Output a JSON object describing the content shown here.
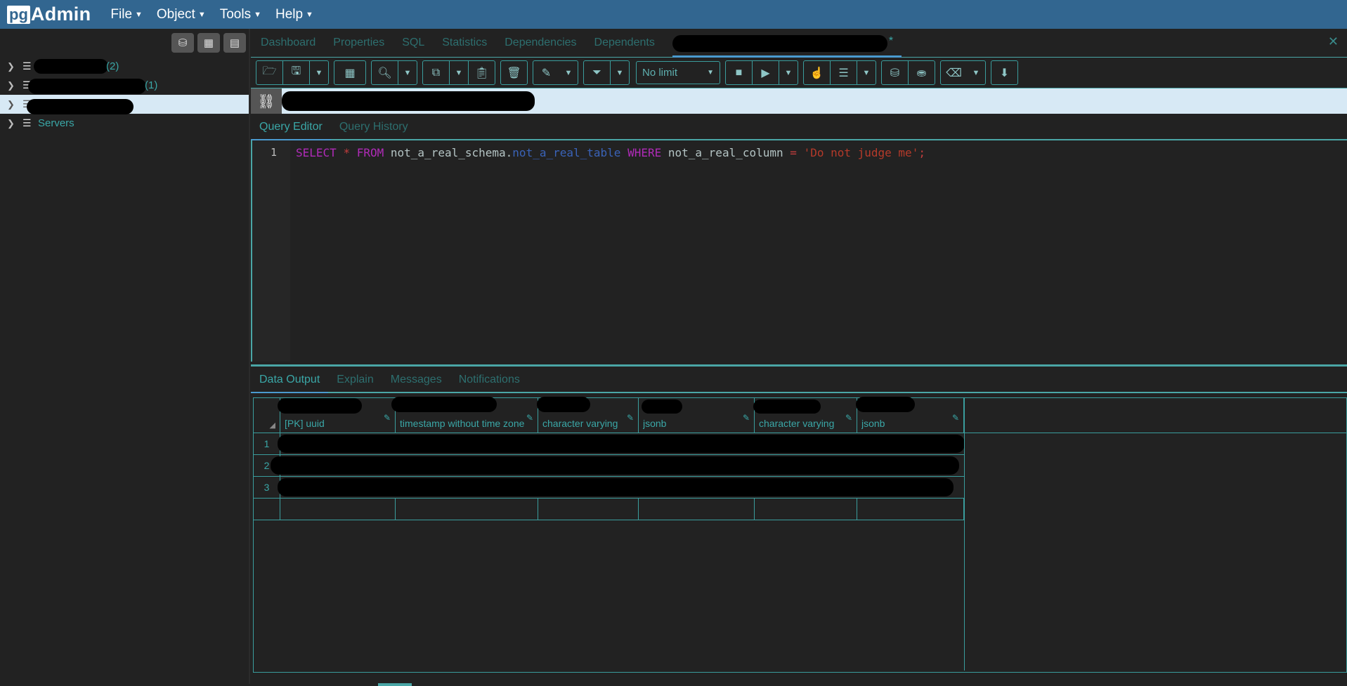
{
  "app": {
    "logo_box": "pg",
    "logo_text": "Admin"
  },
  "menu": [
    {
      "label": "File"
    },
    {
      "label": "Object"
    },
    {
      "label": "Tools"
    },
    {
      "label": "Help"
    }
  ],
  "browser": {
    "tree": [
      {
        "suffix": "(2)"
      },
      {
        "suffix": "(1)"
      },
      {
        "suffix": ""
      },
      {
        "label": "Servers"
      }
    ]
  },
  "tabs": {
    "items": [
      "Dashboard",
      "Properties",
      "SQL",
      "Statistics",
      "Dependencies",
      "Dependents"
    ],
    "active_marker": "*"
  },
  "toolbar": {
    "limit": "No limit"
  },
  "editor": {
    "tabs": [
      "Query Editor",
      "Query History"
    ],
    "line": "1",
    "sql": {
      "kw_select": "SELECT",
      "star": "*",
      "kw_from": "FROM",
      "schema": "not_a_real_schema",
      "dot": ".",
      "table": "not_a_real_table",
      "kw_where": "WHERE",
      "column": "not_a_real_column",
      "eq": "=",
      "value": "'Do not judge me'",
      "semi": ";"
    }
  },
  "results": {
    "tabs": [
      "Data Output",
      "Explain",
      "Messages",
      "Notifications"
    ],
    "columns": [
      {
        "type": "[PK] uuid"
      },
      {
        "type": "timestamp without time zone"
      },
      {
        "type": "character varying"
      },
      {
        "type": "jsonb"
      },
      {
        "type": "character varying"
      },
      {
        "type": "jsonb"
      }
    ],
    "rows": [
      "1",
      "2",
      "3"
    ]
  }
}
